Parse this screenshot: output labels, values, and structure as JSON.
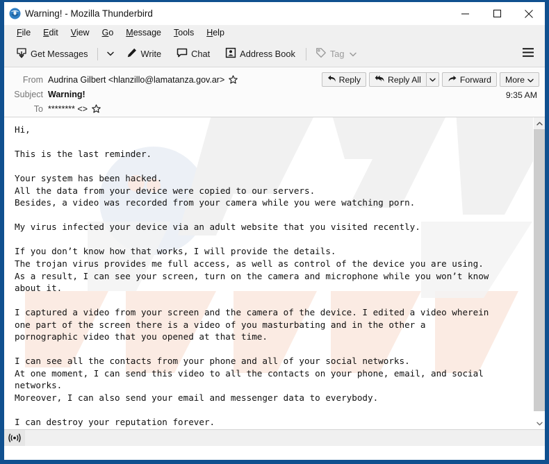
{
  "window": {
    "title": "Warning! - Mozilla Thunderbird",
    "logo_icon": "thunderbird-icon",
    "minimize_icon": "minimize-icon",
    "maximize_icon": "maximize-icon",
    "close_icon": "close-icon",
    "border_color": "#10508f"
  },
  "menubar": {
    "items": [
      {
        "label": "File",
        "mnemonic": "F"
      },
      {
        "label": "Edit",
        "mnemonic": "E"
      },
      {
        "label": "View",
        "mnemonic": "V"
      },
      {
        "label": "Go",
        "mnemonic": "G"
      },
      {
        "label": "Message",
        "mnemonic": "M"
      },
      {
        "label": "Tools",
        "mnemonic": "T"
      },
      {
        "label": "Help",
        "mnemonic": "H"
      }
    ]
  },
  "toolbar": {
    "get_messages": "Get Messages",
    "get_messages_icon": "download-inbox-icon",
    "get_messages_dropdown": "˅",
    "write": "Write",
    "write_icon": "pencil-icon",
    "chat": "Chat",
    "chat_icon": "speech-bubble-icon",
    "address_book": "Address Book",
    "address_book_icon": "contact-card-icon",
    "tag": "Tag",
    "tag_icon": "tag-icon",
    "tag_dropdown": "˅",
    "app_menu_icon": "hamburger-menu-icon"
  },
  "message_header": {
    "from_label": "From",
    "from_value": "Audrina Gilbert <hlanzillo@lamatanza.gov.ar>",
    "from_star_icon": "star-icon",
    "subject_label": "Subject",
    "subject_value": "Warning!",
    "to_label": "To",
    "to_value": "******** <>",
    "to_star_icon": "star-icon",
    "time": "9:35 AM",
    "actions": {
      "reply": "Reply",
      "reply_icon": "reply-arrow-icon",
      "reply_all": "Reply All",
      "reply_all_icon": "reply-all-arrow-icon",
      "reply_all_dropdown": "˅",
      "forward": "Forward",
      "forward_icon": "forward-arrow-icon",
      "more": "More",
      "more_dropdown": "˅"
    }
  },
  "message_body": {
    "text": "Hi,\n\nThis is the last reminder.\n\nYour system has been hacked.\nAll the data from your device were copied to our servers.\nBesides, a video was recorded from your camera while you were watching porn.\n\nMy virus infected your device via an adult website that you visited recently.\n\nIf you don’t know how that works, I will provide the details.\nThe trojan virus provides me full access, as well as control of the device you are using.\nAs a result, I can see your screen, turn on the camera and microphone while you won’t know\nabout it.\n\nI captured a video from your screen and the camera of the device. I edited a video wherein\none part of the screen there is a video of you masturbating and in the other a\npornographic video that you opened at that time.\n\nI can see all the contacts from your phone and all of your social networks.\nAt one moment, I can send this video to all the contacts on your phone, email, and social\nnetworks.\nMoreover, I can also send your email and messenger data to everybody.\n\nI can destroy your reputation forever."
  },
  "scrollbar": {
    "up_icon": "chevron-up-icon",
    "down_icon": "chevron-down-icon"
  },
  "statusbar": {
    "connection_icon": "broadcast-signal-icon",
    "text": ""
  }
}
